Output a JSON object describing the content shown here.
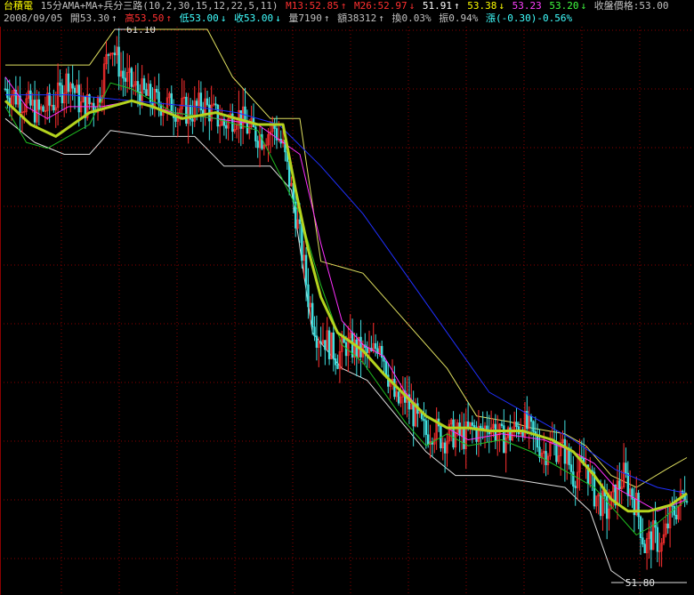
{
  "header": {
    "stock_name": "台積電",
    "indicator": "15分AMA+MA+兵分三路(10,2,30,15,12,22,5,11)",
    "m13": "M13:52.85",
    "m13_arrow": "↑",
    "m26": "M26:52.97",
    "m26_arrow": "↓",
    "v1": "51.91",
    "v1_arrow": "↑",
    "v2": "53.38",
    "v2_arrow": "↓",
    "v3": "53.23",
    "v4": "53.20",
    "v4_arrow": "↓",
    "close_label": "收盤價格:53.00"
  },
  "quote": {
    "date": "2008/09/05",
    "open": "開53.30",
    "open_arrow": "↑",
    "high": "高53.50",
    "high_arrow": "↑",
    "low": "低53.00",
    "low_arrow": "↓",
    "close": "收53.00",
    "close_arrow": "↓",
    "volume": "量7190",
    "volume_arrow": "↑",
    "amount": "額38312",
    "amount_arrow": "↑",
    "turnover": "換0.03%",
    "amplitude": "振0.94%",
    "change": "漲(-0.30)-0.56%"
  },
  "colors": {
    "background": "#000000",
    "grid": "#8b0000",
    "up": "#ff3030",
    "down": "#40e0e0",
    "ama": "#b4d31e",
    "ma_blue": "#2030ff",
    "ma_magenta": "#ff30ff",
    "ma_green": "#20c020",
    "band_yellow": "#e0e060",
    "band_white": "#e0e0e0",
    "label_yellow": "#ffff00",
    "label_red": "#ff3030",
    "label_cyan": "#40ffff",
    "label_magenta": "#ff40ff",
    "label_green": "#40ff40",
    "label_white": "#ffffff"
  },
  "chart_data": {
    "type": "candlestick",
    "ylim": [
      51.8,
      61.1
    ],
    "grid": true,
    "max_label": "61.10",
    "min_label": "51.80",
    "price_path": [
      [
        0,
        60.1
      ],
      [
        8,
        59.9
      ],
      [
        16,
        59.7
      ],
      [
        24,
        59.9
      ],
      [
        30,
        60.3
      ],
      [
        36,
        59.8
      ],
      [
        44,
        59.9
      ],
      [
        50,
        60.9
      ],
      [
        56,
        60.3
      ],
      [
        62,
        60.1
      ],
      [
        70,
        59.9
      ],
      [
        80,
        59.8
      ],
      [
        88,
        59.7
      ],
      [
        94,
        59.85
      ],
      [
        98,
        59.7
      ],
      [
        104,
        59.5
      ],
      [
        110,
        59.7
      ],
      [
        116,
        59.4
      ],
      [
        122,
        59.3
      ],
      [
        128,
        59.45
      ],
      [
        132,
        59.1
      ],
      [
        136,
        58.4
      ],
      [
        140,
        57.6
      ],
      [
        144,
        56.6
      ],
      [
        148,
        56.0
      ],
      [
        152,
        55.9
      ],
      [
        158,
        55.6
      ],
      [
        162,
        55.8
      ],
      [
        168,
        55.7
      ],
      [
        174,
        55.6
      ],
      [
        178,
        55.9
      ],
      [
        182,
        55.3
      ],
      [
        186,
        54.8
      ],
      [
        190,
        54.9
      ],
      [
        196,
        54.5
      ],
      [
        200,
        54.3
      ],
      [
        204,
        54.4
      ],
      [
        208,
        54.2
      ],
      [
        212,
        54.3
      ],
      [
        218,
        54.25
      ],
      [
        222,
        54.4
      ],
      [
        226,
        54.3
      ],
      [
        230,
        54.5
      ],
      [
        236,
        54.2
      ],
      [
        240,
        54.3
      ],
      [
        246,
        54.5
      ],
      [
        250,
        54.3
      ],
      [
        256,
        54.0
      ],
      [
        260,
        54.1
      ],
      [
        266,
        54.0
      ],
      [
        270,
        53.6
      ],
      [
        276,
        53.8
      ],
      [
        280,
        53.3
      ],
      [
        286,
        53.0
      ],
      [
        290,
        53.3
      ],
      [
        294,
        53.6
      ],
      [
        300,
        53.1
      ],
      [
        304,
        52.4
      ],
      [
        308,
        52.6
      ],
      [
        312,
        52.4
      ],
      [
        316,
        52.9
      ],
      [
        320,
        53.1
      ],
      [
        324,
        53.4
      ]
    ],
    "ama_path": [
      [
        0,
        59.9
      ],
      [
        12,
        59.5
      ],
      [
        24,
        59.3
      ],
      [
        40,
        59.7
      ],
      [
        60,
        59.9
      ],
      [
        70,
        59.8
      ],
      [
        84,
        59.6
      ],
      [
        100,
        59.7
      ],
      [
        120,
        59.5
      ],
      [
        132,
        59.5
      ],
      [
        138,
        58.4
      ],
      [
        144,
        57.4
      ],
      [
        150,
        56.6
      ],
      [
        158,
        56.0
      ],
      [
        170,
        55.7
      ],
      [
        180,
        55.3
      ],
      [
        190,
        54.95
      ],
      [
        200,
        54.6
      ],
      [
        210,
        54.4
      ],
      [
        220,
        54.4
      ],
      [
        230,
        54.35
      ],
      [
        246,
        54.35
      ],
      [
        260,
        54.2
      ],
      [
        270,
        54.0
      ],
      [
        280,
        53.6
      ],
      [
        288,
        53.2
      ],
      [
        296,
        53.0
      ],
      [
        306,
        53.0
      ],
      [
        316,
        53.1
      ],
      [
        324,
        53.3
      ]
    ],
    "ma_blue_path": [
      [
        0,
        60.0
      ],
      [
        30,
        60.0
      ],
      [
        60,
        59.9
      ],
      [
        90,
        59.8
      ],
      [
        110,
        59.7
      ],
      [
        130,
        59.5
      ],
      [
        150,
        58.8
      ],
      [
        170,
        58.0
      ],
      [
        190,
        57.0
      ],
      [
        210,
        56.0
      ],
      [
        230,
        55.0
      ],
      [
        250,
        54.6
      ],
      [
        270,
        54.2
      ],
      [
        290,
        53.7
      ],
      [
        310,
        53.4
      ],
      [
        324,
        53.3
      ]
    ],
    "ma_magenta_path": [
      [
        0,
        60.3
      ],
      [
        10,
        59.8
      ],
      [
        20,
        59.6
      ],
      [
        30,
        59.8
      ],
      [
        46,
        59.8
      ],
      [
        60,
        59.9
      ],
      [
        80,
        59.7
      ],
      [
        100,
        59.6
      ],
      [
        120,
        59.5
      ],
      [
        140,
        59.0
      ],
      [
        150,
        57.5
      ],
      [
        160,
        56.2
      ],
      [
        170,
        55.8
      ],
      [
        180,
        55.6
      ],
      [
        190,
        55.0
      ],
      [
        200,
        54.6
      ],
      [
        210,
        54.4
      ],
      [
        220,
        54.2
      ],
      [
        236,
        54.3
      ],
      [
        256,
        54.2
      ],
      [
        270,
        54.0
      ],
      [
        280,
        53.8
      ],
      [
        290,
        53.4
      ],
      [
        300,
        53.2
      ],
      [
        310,
        53.0
      ],
      [
        324,
        53.2
      ]
    ],
    "ma_green_path": [
      [
        0,
        59.8
      ],
      [
        10,
        59.2
      ],
      [
        20,
        59.1
      ],
      [
        30,
        59.3
      ],
      [
        40,
        59.5
      ],
      [
        50,
        60.2
      ],
      [
        60,
        60.1
      ],
      [
        80,
        59.7
      ],
      [
        100,
        59.6
      ],
      [
        120,
        59.4
      ],
      [
        140,
        58.0
      ],
      [
        150,
        56.8
      ],
      [
        160,
        55.8
      ],
      [
        170,
        55.5
      ],
      [
        180,
        55.0
      ],
      [
        190,
        54.5
      ],
      [
        200,
        54.1
      ],
      [
        210,
        54.3
      ],
      [
        220,
        54.1
      ],
      [
        236,
        54.2
      ],
      [
        250,
        54.0
      ],
      [
        260,
        53.8
      ],
      [
        270,
        53.6
      ],
      [
        280,
        53.4
      ],
      [
        290,
        53.0
      ],
      [
        300,
        52.6
      ],
      [
        310,
        52.8
      ],
      [
        324,
        53.2
      ]
    ],
    "band_upper_path": [
      [
        0,
        60.5
      ],
      [
        20,
        60.5
      ],
      [
        40,
        60.5
      ],
      [
        52,
        61.1
      ],
      [
        80,
        61.1
      ],
      [
        96,
        61.1
      ],
      [
        108,
        60.3
      ],
      [
        126,
        59.6
      ],
      [
        140,
        59.6
      ],
      [
        150,
        57.2
      ],
      [
        170,
        57.0
      ],
      [
        190,
        56.2
      ],
      [
        210,
        55.4
      ],
      [
        224,
        54.6
      ],
      [
        240,
        54.5
      ],
      [
        250,
        54.4
      ],
      [
        266,
        54.3
      ],
      [
        276,
        54.1
      ],
      [
        288,
        53.6
      ],
      [
        300,
        53.4
      ],
      [
        314,
        53.7
      ],
      [
        324,
        53.9
      ]
    ],
    "band_lower_path": [
      [
        0,
        59.6
      ],
      [
        14,
        59.2
      ],
      [
        28,
        59.0
      ],
      [
        40,
        59.0
      ],
      [
        50,
        59.4
      ],
      [
        70,
        59.3
      ],
      [
        90,
        59.3
      ],
      [
        104,
        58.8
      ],
      [
        126,
        58.8
      ],
      [
        136,
        58.4
      ],
      [
        146,
        56.0
      ],
      [
        160,
        55.4
      ],
      [
        172,
        55.2
      ],
      [
        186,
        54.6
      ],
      [
        200,
        54.0
      ],
      [
        214,
        53.6
      ],
      [
        230,
        53.6
      ],
      [
        248,
        53.5
      ],
      [
        266,
        53.4
      ],
      [
        278,
        53.0
      ],
      [
        288,
        52.0
      ],
      [
        296,
        51.8
      ],
      [
        310,
        51.8
      ],
      [
        324,
        51.8
      ]
    ]
  }
}
